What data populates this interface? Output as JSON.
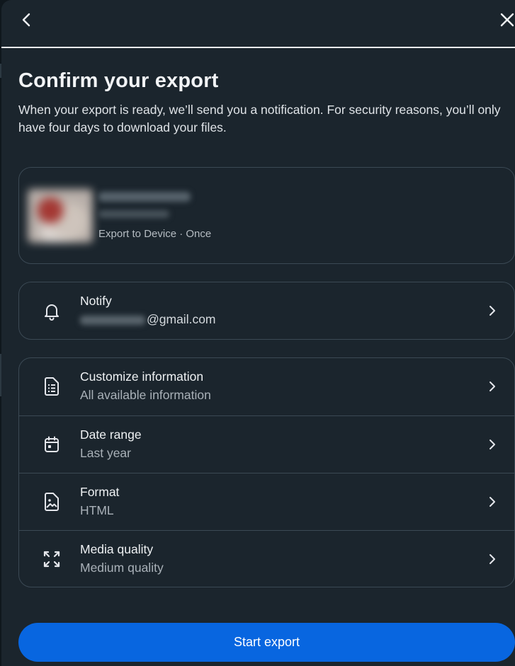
{
  "header": {
    "back_icon": "chevron-left-icon",
    "close_icon": "close-icon"
  },
  "page": {
    "title": "Confirm your export",
    "subtitle": "When your export is ready, we’ll send you a notification. For security reasons, you’ll only have four days to download your files."
  },
  "account": {
    "meta": "Export to Device · Once"
  },
  "notify": {
    "icon": "bell-icon",
    "title": "Notify",
    "email_suffix": "@gmail.com"
  },
  "settings": [
    {
      "icon": "document-list-icon",
      "title": "Customize information",
      "value": "All available information"
    },
    {
      "icon": "calendar-icon",
      "title": "Date range",
      "value": "Last year"
    },
    {
      "icon": "image-file-icon",
      "title": "Format",
      "value": "HTML"
    },
    {
      "icon": "expand-arrows-icon",
      "title": "Media quality",
      "value": "Medium quality"
    }
  ],
  "footer": {
    "start_label": "Start export",
    "accent": "#0866e0"
  }
}
